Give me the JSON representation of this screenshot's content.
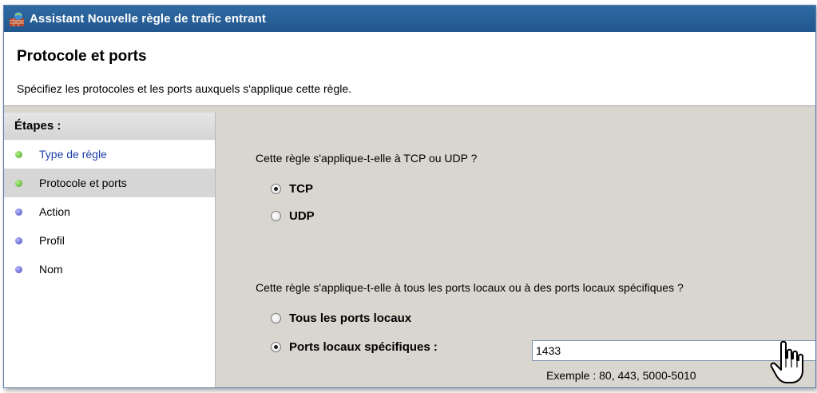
{
  "window": {
    "title": "Assistant Nouvelle règle de trafic entrant"
  },
  "header": {
    "title": "Protocole et ports",
    "subtitle": "Spécifiez les protocoles et les ports auxquels s'applique cette règle."
  },
  "sidebar": {
    "title": "Étapes :",
    "steps": [
      {
        "label": "Type de règle",
        "status": "green"
      },
      {
        "label": "Protocole et ports",
        "status": "green"
      },
      {
        "label": "Action",
        "status": "blue"
      },
      {
        "label": "Profil",
        "status": "blue"
      },
      {
        "label": "Nom",
        "status": "blue"
      }
    ]
  },
  "protocol": {
    "question": "Cette règle s'applique-t-elle à TCP ou UDP ?",
    "options": [
      {
        "label": "TCP",
        "checked": true
      },
      {
        "label": "UDP",
        "checked": false
      }
    ]
  },
  "ports": {
    "question": "Cette règle s'applique-t-elle à tous les ports locaux ou à des ports locaux spécifiques ?",
    "options": [
      {
        "label": "Tous les ports locaux",
        "checked": false
      },
      {
        "label": "Ports locaux spécifiques :",
        "checked": true
      }
    ],
    "value": "1433",
    "example": "Exemple : 80, 443, 5000-5010"
  },
  "colors": {
    "titlebar": "#2a63a0",
    "link": "#1c3fa8",
    "content_bg": "#d9d6cf",
    "done_dot": "#3ea320",
    "pending_dot": "#4349b8"
  }
}
